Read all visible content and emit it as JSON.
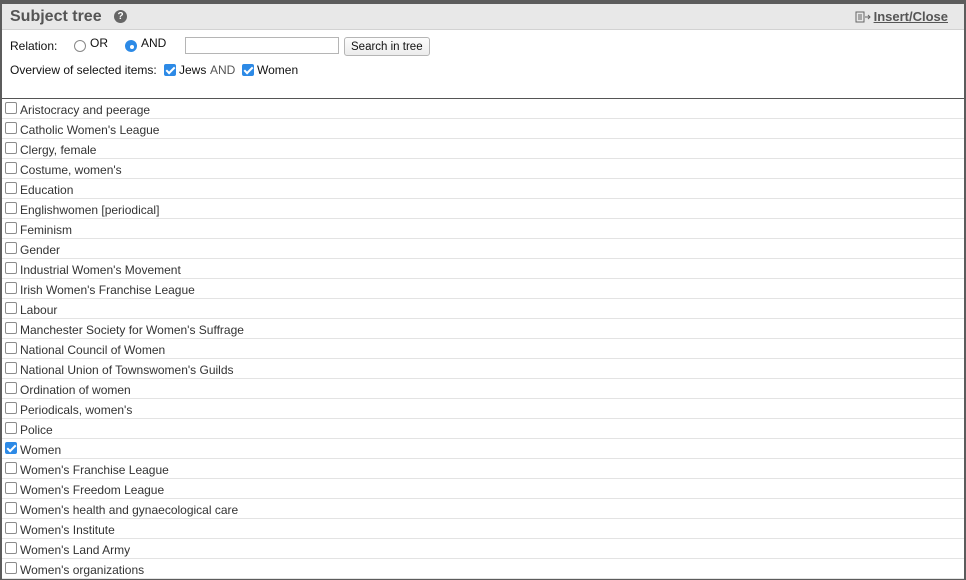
{
  "header": {
    "title": "Subject tree",
    "insert_close": "Insert/Close"
  },
  "controls": {
    "relation_label": "Relation:",
    "or_label": "OR",
    "and_label": "AND",
    "selected_relation": "AND",
    "search_value": "",
    "search_button": "Search in tree",
    "overview_label": "Overview of selected items:",
    "selected_items": [
      "Jews",
      "Women"
    ],
    "joiner": "AND"
  },
  "list": {
    "items": [
      {
        "label": "Aristocracy and peerage",
        "checked": false
      },
      {
        "label": "Catholic Women's League",
        "checked": false
      },
      {
        "label": "Clergy, female",
        "checked": false
      },
      {
        "label": "Costume, women's",
        "checked": false
      },
      {
        "label": "Education",
        "checked": false
      },
      {
        "label": "Englishwomen [periodical]",
        "checked": false
      },
      {
        "label": "Feminism",
        "checked": false
      },
      {
        "label": "Gender",
        "checked": false
      },
      {
        "label": "Industrial Women's Movement",
        "checked": false
      },
      {
        "label": "Irish Women's Franchise League",
        "checked": false
      },
      {
        "label": "Labour",
        "checked": false
      },
      {
        "label": "Manchester Society for Women's Suffrage",
        "checked": false
      },
      {
        "label": "National Council of Women",
        "checked": false
      },
      {
        "label": "National Union of Townswomen's Guilds",
        "checked": false
      },
      {
        "label": "Ordination of women",
        "checked": false
      },
      {
        "label": "Periodicals, women's",
        "checked": false
      },
      {
        "label": "Police",
        "checked": false
      },
      {
        "label": "Women",
        "checked": true
      },
      {
        "label": "Women's Franchise League",
        "checked": false
      },
      {
        "label": "Women's Freedom League",
        "checked": false
      },
      {
        "label": "Women's health and gynaecological care",
        "checked": false
      },
      {
        "label": "Women's Institute",
        "checked": false
      },
      {
        "label": "Women's Land Army",
        "checked": false
      },
      {
        "label": "Women's organizations",
        "checked": false
      }
    ]
  },
  "colors": {
    "accent": "#2d8ae6",
    "header_bg": "#e8e8e8",
    "border": "#5c5c5c"
  }
}
